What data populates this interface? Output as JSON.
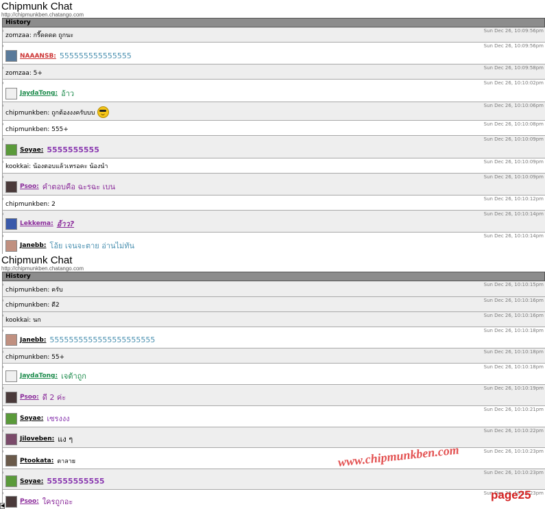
{
  "panels": [
    {
      "title": "Chipmunk Chat",
      "url": "http://chipmunkben.chatango.com",
      "history_label": "History",
      "rows": [
        {
          "type": "plain",
          "h": 22,
          "bg": "alt",
          "text": "zomzaa: กรี๊ดดดด ถูกนะ",
          "time": "Sun Dec 26, 10:09:56pm"
        },
        {
          "type": "rich",
          "h": 32,
          "bg": "white",
          "user": "NAAANSB:",
          "msg": "555555555555555",
          "ucolor": "#cc3333",
          "mcolor": "#4a90b0",
          "avatar": "#5a7a9a",
          "time": "Sun Dec 26, 10:09:56pm"
        },
        {
          "type": "plain",
          "h": 22,
          "bg": "alt",
          "text": "zomzaa: 5+",
          "time": "Sun Dec 26, 10:09:58pm"
        },
        {
          "type": "rich",
          "h": 33,
          "bg": "white",
          "user": "JaydaTong:",
          "msg": "อ้าว",
          "ucolor": "#1a8a4a",
          "mcolor": "#1a8a4a",
          "avatar": "#f0f0f0",
          "time": "Sun Dec 26, 10:10:02pm"
        },
        {
          "type": "rich",
          "h": 27,
          "bg": "alt",
          "user": "",
          "plainlabel": "chipmunkben: ถูกต้องงงครับบบ",
          "msg": "",
          "emoji": true,
          "time": "Sun Dec 26, 10:10:06pm"
        },
        {
          "type": "plain",
          "h": 22,
          "bg": "white",
          "text": "chipmunkben: 555+",
          "time": "Sun Dec 26, 10:10:08pm"
        },
        {
          "type": "rich",
          "h": 33,
          "bg": "alt",
          "user": "Soyae:",
          "msg": "5555555555",
          "ucolor": "#000000",
          "mcolor": "#8a3ab0",
          "avatar": "#5a9a3a",
          "bold": true,
          "time": "Sun Dec 26, 10:10:09pm"
        },
        {
          "type": "plain",
          "h": 22,
          "bg": "white",
          "text": "kookkai: น้องตอบแล้วเหรอคะ น้องนำ",
          "time": "Sun Dec 26, 10:10:09pm"
        },
        {
          "type": "rich",
          "h": 32,
          "bg": "alt",
          "user": "Psoo:",
          "msg": "คำตอบคือ ฉะรฉะ เบน",
          "ucolor": "#8a2a9a",
          "mcolor": "#8a2a9a",
          "avatar": "#4a3a3a",
          "time": "Sun Dec 26, 10:10:09pm"
        },
        {
          "type": "plain",
          "h": 22,
          "bg": "white",
          "text": "chipmunkben: 2",
          "time": "Sun Dec 26, 10:10:12pm"
        },
        {
          "type": "rich",
          "h": 32,
          "bg": "alt",
          "user": "Lekkema:",
          "msg": "อ้าว?",
          "ucolor": "#8a2a9a",
          "mcolor": "#8a2a9a",
          "avatar": "#3a5aaa",
          "italic": true,
          "time": "Sun Dec 26, 10:10:14pm"
        },
        {
          "type": "rich",
          "h": 32,
          "bg": "white",
          "user": "Janebb:",
          "msg": "โอ้ย เจนจะตาย อ่านไม่ทัน",
          "ucolor": "#000000",
          "mcolor": "#4a90b0",
          "avatar": "#c09080",
          "time": "Sun Dec 26, 10:10:14pm"
        }
      ]
    },
    {
      "title": "Chipmunk Chat",
      "url": "http://chipmunkben.chatango.com",
      "history_label": "History",
      "rows": [
        {
          "type": "plain",
          "h": 23,
          "bg": "alt",
          "text": "chipmunkben: ครับ",
          "time": "Sun Dec 26, 10:10:15pm"
        },
        {
          "type": "plain",
          "h": 22,
          "bg": "alt",
          "text": "chipmunkben: ดี2",
          "time": "Sun Dec 26, 10:10:16pm"
        },
        {
          "type": "plain",
          "h": 22,
          "bg": "alt",
          "text": "kookkai: นก",
          "time": "Sun Dec 26, 10:10:16pm"
        },
        {
          "type": "rich",
          "h": 31,
          "bg": "white",
          "user": "Janebb:",
          "msg": "5555555555555555555555",
          "ucolor": "#000000",
          "mcolor": "#4a90b0",
          "avatar": "#c09080",
          "time": "Sun Dec 26, 10:10:18pm"
        },
        {
          "type": "plain",
          "h": 22,
          "bg": "alt",
          "text": "chipmunkben: 55+",
          "time": "Sun Dec 26, 10:10:18pm"
        },
        {
          "type": "rich",
          "h": 31,
          "bg": "white",
          "user": "JaydaTong:",
          "msg": "เจต้าถูก",
          "ucolor": "#1a8a4a",
          "mcolor": "#1a8a4a",
          "avatar": "#f0f0f0",
          "time": "Sun Dec 26, 10:10:18pm"
        },
        {
          "type": "rich",
          "h": 31,
          "bg": "alt",
          "user": "Psoo:",
          "msg": "ดี 2 ค่ะ",
          "ucolor": "#8a2a9a",
          "mcolor": "#8a2a9a",
          "avatar": "#4a3a3a",
          "time": "Sun Dec 26, 10:10:19pm"
        },
        {
          "type": "rich",
          "h": 31,
          "bg": "white",
          "user": "Soyae:",
          "msg": "เซรงงง",
          "ucolor": "#000000",
          "mcolor": "#8a3ab0",
          "avatar": "#5a9a3a",
          "time": "Sun Dec 26, 10:10:21pm"
        },
        {
          "type": "rich",
          "h": 30,
          "bg": "alt",
          "user": "Jiloveben:",
          "msg": "แง ๆ",
          "ucolor": "#000000",
          "mcolor": "#000000",
          "avatar": "#7a4a6a",
          "time": "Sun Dec 26, 10:10:22pm"
        },
        {
          "type": "rich",
          "h": 31,
          "bg": "white",
          "user": "Ptookata:",
          "msg": "ตาลาย",
          "ucolor": "#000000",
          "mcolor": "#000000",
          "avatar": "#6a5a4a",
          "small": true,
          "time": "Sun Dec 26, 10:10:23pm"
        },
        {
          "type": "rich",
          "h": 30,
          "bg": "alt",
          "user": "Soyae:",
          "msg": "55555555555",
          "ucolor": "#000000",
          "mcolor": "#8a3ab0",
          "avatar": "#5a9a3a",
          "bold": true,
          "time": "Sun Dec 26, 10:10:23pm"
        },
        {
          "type": "rich",
          "h": 30,
          "bg": "white",
          "user": "Psoo:",
          "msg": "ใครถูกอะ",
          "ucolor": "#8a2a9a",
          "mcolor": "#8a2a9a",
          "avatar": "#4a3a3a",
          "time": "Sun Dec 26, 10:10:23pm"
        }
      ]
    }
  ],
  "watermark": "www.chipmunkben.com",
  "page_label": "page25"
}
